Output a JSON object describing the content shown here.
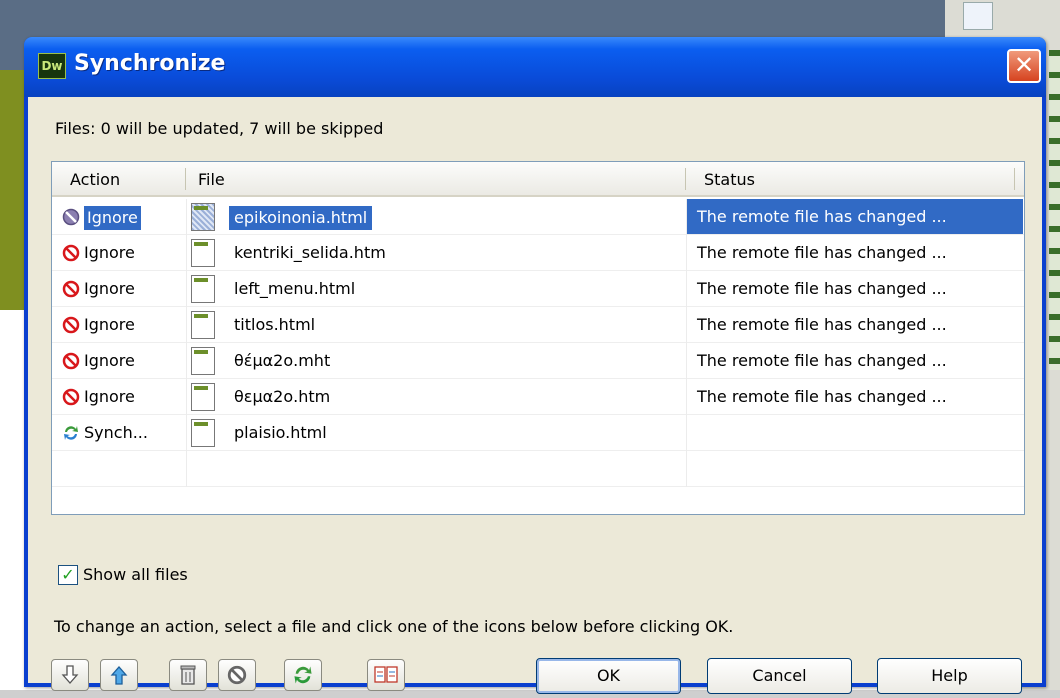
{
  "window": {
    "app_icon": "Dw",
    "title": "Synchronize",
    "close_icon": "close-icon"
  },
  "summary": "Files: 0 will be updated, 7 will be skipped",
  "table": {
    "columns": [
      "Action",
      "File",
      "Status"
    ],
    "rows": [
      {
        "action": "Ignore",
        "action_icon": "ignore-icon",
        "file": "epikoinonia.html",
        "status": "The remote file has changed ...",
        "selected": true
      },
      {
        "action": "Ignore",
        "action_icon": "ignore-icon",
        "file": "kentriki_selida.htm",
        "status": "The remote file has changed ..."
      },
      {
        "action": "Ignore",
        "action_icon": "ignore-icon",
        "file": "left_menu.html",
        "status": "The remote file has changed ..."
      },
      {
        "action": "Ignore",
        "action_icon": "ignore-icon",
        "file": "titlos.html",
        "status": "The remote file has changed ..."
      },
      {
        "action": "Ignore",
        "action_icon": "ignore-icon",
        "file": "θέμα2ο.mht",
        "status": "The remote file has changed ..."
      },
      {
        "action": "Ignore",
        "action_icon": "ignore-icon",
        "file": "θεμα2ο.htm",
        "status": "The remote file has changed ..."
      },
      {
        "action": "Synch...",
        "action_icon": "synchronize-icon",
        "file": "plaisio.html",
        "status": ""
      }
    ]
  },
  "show_all_files": {
    "label": "Show all files",
    "checked": true
  },
  "hint": "To change an action, select a file and click one of the icons below before clicking OK.",
  "toolbar": {
    "icons": [
      "get-icon",
      "put-icon",
      "delete-icon",
      "ignore-icon",
      "synchronize-icon",
      "compare-icon"
    ]
  },
  "buttons": {
    "ok": "OK",
    "cancel": "Cancel",
    "help": "Help"
  },
  "colors": {
    "selection": "#316ac5",
    "titlebar": "#0a4bd8",
    "dialog_bg": "#ece9d8"
  }
}
